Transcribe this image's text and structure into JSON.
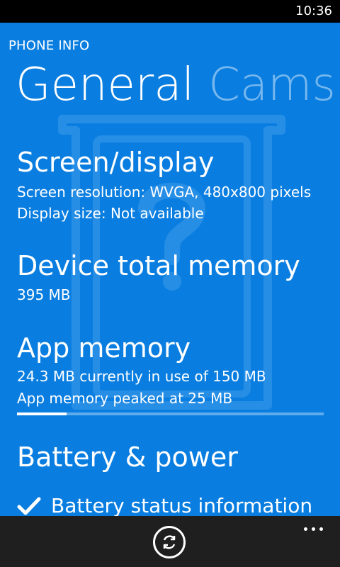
{
  "status_bar": {
    "time": "10:36"
  },
  "app": {
    "title": "PHONE INFO"
  },
  "pivot": {
    "active": "General",
    "next": "Cams"
  },
  "sections": {
    "screen": {
      "heading": "Screen/display",
      "resolution": "Screen resolution: WVGA, 480x800 pixels",
      "display_size": "Display size: Not available"
    },
    "memory": {
      "heading": "Device total memory",
      "value": "395 MB"
    },
    "app_memory": {
      "heading": "App memory",
      "current": "24.3 MB currently in use of 150 MB",
      "peak": "App memory peaked at 25 MB",
      "usage_fraction": 0.162
    },
    "battery": {
      "heading": "Battery & power",
      "status_item": "Battery status information"
    }
  },
  "icons": {
    "refresh": "refresh-icon",
    "more": "more-icon",
    "check": "check-icon",
    "watermark": "phone-question-icon"
  },
  "colors": {
    "background": "#0a7ee0",
    "status_bar": "#000000",
    "app_bar": "#1f1f1f",
    "text": "#ffffff"
  }
}
